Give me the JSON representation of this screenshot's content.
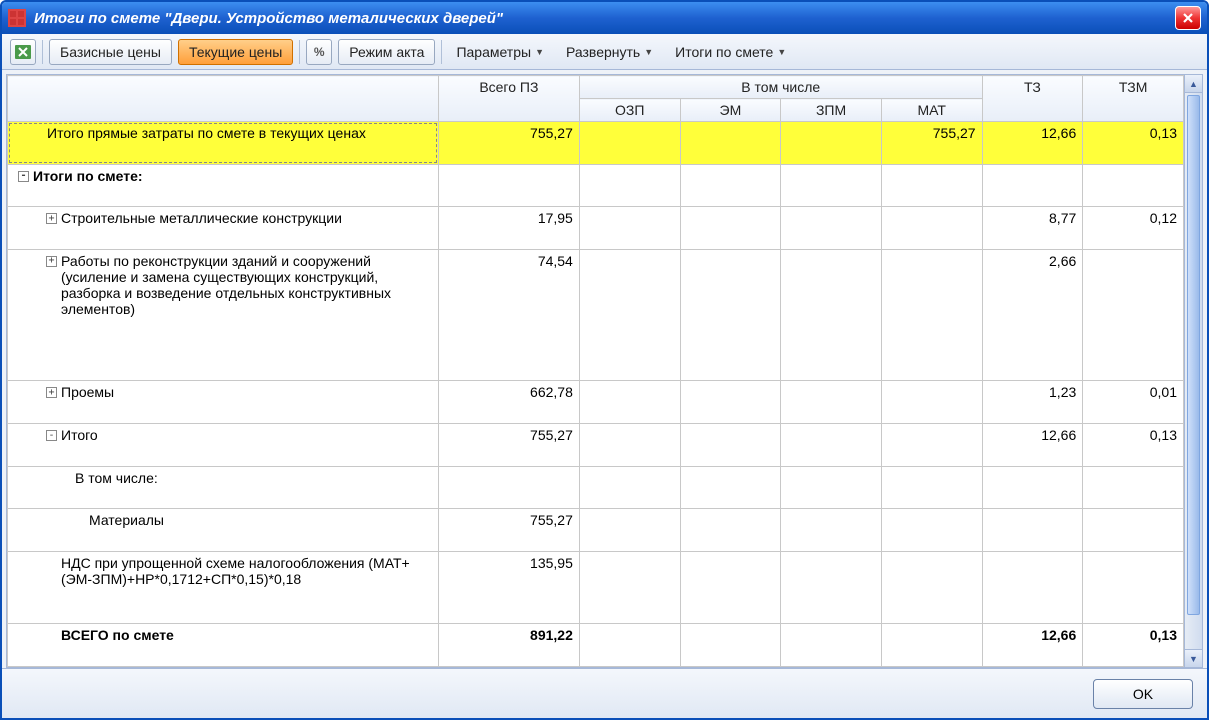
{
  "window": {
    "title": "Итоги по смете \"Двери. Устройство металических дверей\""
  },
  "toolbar": {
    "basic_prices": "Базисные цены",
    "current_prices": "Текущие цены",
    "act_mode": "Режим акта",
    "parameters": "Параметры",
    "expand": "Развернуть",
    "totals": "Итоги по смете"
  },
  "grid": {
    "headers": {
      "total_pz": "Всего ПЗ",
      "including": "В том числе",
      "ozp": "ОЗП",
      "em": "ЭМ",
      "zpm": "ЗПМ",
      "mat": "МАТ",
      "tz": "ТЗ",
      "tzm": "ТЗМ"
    },
    "rows": [
      {
        "label": "Итого прямые затраты по смете в текущих ценах",
        "indent": 1,
        "toggle": "",
        "hl": true,
        "total": "755,27",
        "ozp": "",
        "em": "",
        "zpm": "",
        "mat": "755,27",
        "tz": "12,66",
        "tzm": "0,13"
      },
      {
        "label": "Итоги по смете:",
        "indent": 0,
        "toggle": "-",
        "bold": true,
        "total": "",
        "ozp": "",
        "em": "",
        "zpm": "",
        "mat": "",
        "tz": "",
        "tzm": ""
      },
      {
        "label": "Строительные металлические конструкции",
        "indent": 2,
        "toggle": "+",
        "total": "17,95",
        "ozp": "",
        "em": "",
        "zpm": "",
        "mat": "",
        "tz": "8,77",
        "tzm": "0,12"
      },
      {
        "label": "Работы по реконструкции зданий и сооружений (усиление и замена существующих конструкций, разборка и возведение отдельных конструктивных элементов)",
        "indent": 2,
        "toggle": "+",
        "total": "74,54",
        "ozp": "",
        "em": "",
        "zpm": "",
        "mat": "",
        "tz": "2,66",
        "tzm": ""
      },
      {
        "label": "Проемы",
        "indent": 2,
        "toggle": "+",
        "total": "662,78",
        "ozp": "",
        "em": "",
        "zpm": "",
        "mat": "",
        "tz": "1,23",
        "tzm": "0,01"
      },
      {
        "label": "Итого",
        "indent": 2,
        "toggle": "-",
        "total": "755,27",
        "ozp": "",
        "em": "",
        "zpm": "",
        "mat": "",
        "tz": "12,66",
        "tzm": "0,13"
      },
      {
        "label": "В том числе:",
        "indent": 3,
        "toggle": "",
        "total": "",
        "ozp": "",
        "em": "",
        "zpm": "",
        "mat": "",
        "tz": "",
        "tzm": ""
      },
      {
        "label": "Материалы",
        "indent": 4,
        "toggle": "",
        "total": "755,27",
        "ozp": "",
        "em": "",
        "zpm": "",
        "mat": "",
        "tz": "",
        "tzm": ""
      },
      {
        "label": "НДС при упрощенной схеме налогообложения (МАТ+(ЭМ-ЗПМ)+НР*0,1712+СП*0,15)*0,18",
        "indent": 2,
        "toggle": "",
        "total": "135,95",
        "ozp": "",
        "em": "",
        "zpm": "",
        "mat": "",
        "tz": "",
        "tzm": ""
      },
      {
        "label": "ВСЕГО по смете",
        "indent": 2,
        "toggle": "",
        "bold": true,
        "total": "891,22",
        "ozp": "",
        "em": "",
        "zpm": "",
        "mat": "",
        "tz": "12,66",
        "tzm": "0,13"
      }
    ]
  },
  "footer": {
    "ok": "OK"
  }
}
